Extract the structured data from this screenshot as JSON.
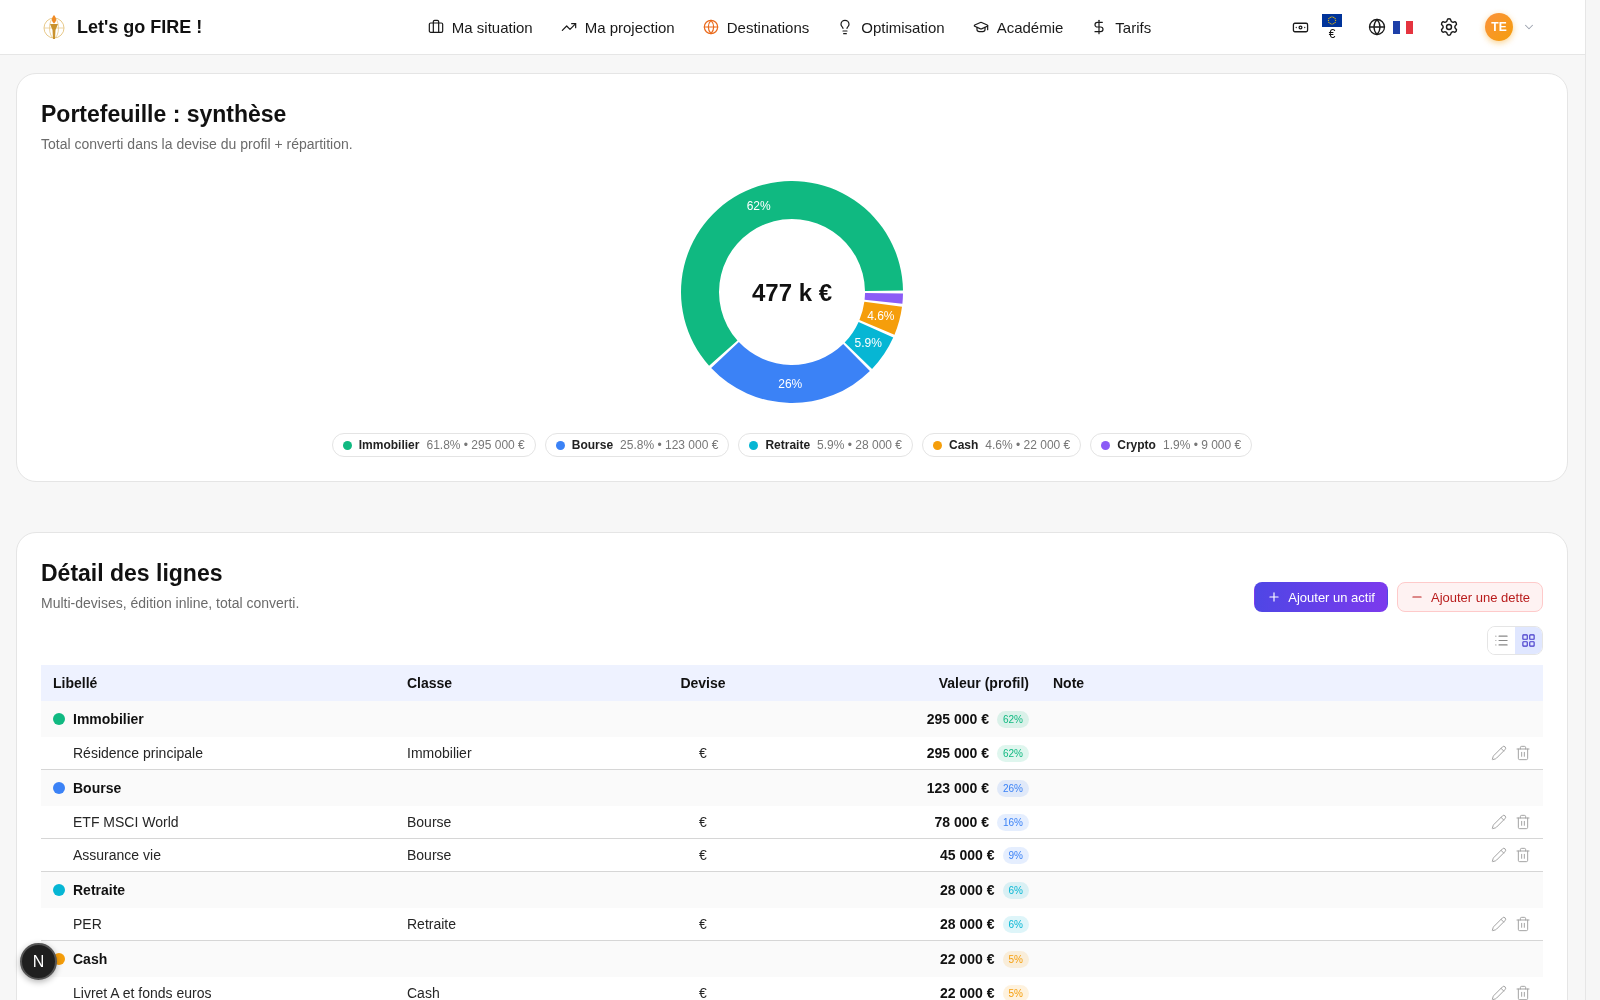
{
  "header": {
    "brand": "Let's go FIRE !",
    "nav": [
      {
        "label": "Ma situation",
        "highlighted": false
      },
      {
        "label": "Ma projection",
        "highlighted": false
      },
      {
        "label": "Destinations",
        "highlighted": true
      },
      {
        "label": "Optimisation",
        "highlighted": false
      },
      {
        "label": "Académie",
        "highlighted": false
      },
      {
        "label": "Tarifs",
        "highlighted": false
      }
    ],
    "currency": "€",
    "avatar": "TE"
  },
  "summary": {
    "title": "Portefeuille : synthèse",
    "subtitle": "Total converti dans la devise du profil + répartition.",
    "total": "477 k €",
    "chart_data": {
      "type": "donut",
      "categories": [
        "Immobilier",
        "Bourse",
        "Retraite",
        "Cash",
        "Crypto"
      ],
      "values": [
        61.8,
        25.8,
        5.9,
        4.6,
        1.9
      ],
      "value_labels": [
        "62%",
        "26%",
        "5.9%",
        "4.6%",
        null
      ]
    },
    "legend": [
      {
        "color": "#10b981",
        "detail": "61.8% • 295 000 €"
      },
      {
        "color": "#3b82f6",
        "detail": "25.8% • 123 000 €"
      },
      {
        "color": "#06b6d4",
        "detail": "5.9% • 28 000 €"
      },
      {
        "color": "#f59e0b",
        "detail": "4.6% • 22 000 €"
      },
      {
        "color": "#8b5cf6",
        "detail": "1.9% • 9 000 €"
      }
    ]
  },
  "details": {
    "title": "Détail des lignes",
    "subtitle": "Multi-devises, édition inline, total converti.",
    "actions": [
      {
        "label": "Ajouter un actif",
        "kind": "primary"
      },
      {
        "label": "Ajouter une dette",
        "kind": "danger"
      }
    ],
    "view_modes": [
      {
        "selected": false
      },
      {
        "selected": true
      }
    ],
    "table": {
      "columns": [
        "Libellé",
        "Classe",
        "Devise",
        "Valeur (profil)",
        "Note"
      ],
      "groups": [
        {
          "name": "Immobilier",
          "color": "#10b981",
          "total": "295 000 €",
          "share": "62%",
          "rows": [
            {
              "label": "Résidence principale",
              "class": "Immobilier",
              "currency": "€",
              "value": "295 000 €",
              "share": "62%"
            }
          ]
        },
        {
          "name": "Bourse",
          "color": "#3b82f6",
          "total": "123 000 €",
          "share": "26%",
          "rows": [
            {
              "label": "ETF MSCI World",
              "class": "Bourse",
              "currency": "€",
              "value": "78 000 €",
              "share": "16%"
            },
            {
              "label": "Assurance vie",
              "class": "Bourse",
              "currency": "€",
              "value": "45 000 €",
              "share": "9%"
            }
          ]
        },
        {
          "name": "Retraite",
          "color": "#06b6d4",
          "total": "28 000 €",
          "share": "6%",
          "rows": [
            {
              "label": "PER",
              "class": "Retraite",
              "currency": "€",
              "value": "28 000 €",
              "share": "6%"
            }
          ]
        },
        {
          "name": "Cash",
          "color": "#f59e0b",
          "total": "22 000 €",
          "share": "5%",
          "rows": [
            {
              "label": "Livret A et fonds euros",
              "class": "Cash",
              "currency": "€",
              "value": "22 000 €",
              "share": "5%"
            }
          ]
        }
      ]
    }
  },
  "dev_badge": "N"
}
